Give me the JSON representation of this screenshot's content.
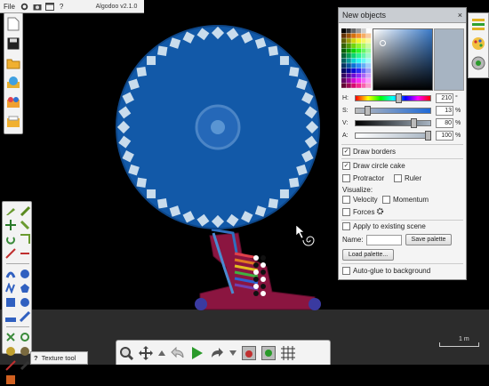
{
  "app": {
    "title": "Algodoo v2.1.0"
  },
  "menu": {
    "file_label": "File",
    "help_label": "?"
  },
  "tooltip": {
    "hint_label": "?",
    "text": "Texture tool"
  },
  "scale": {
    "label": "1 m"
  },
  "new_objects": {
    "title": "New objects",
    "close_label": "×",
    "sliders": [
      {
        "label": "H:",
        "value": "210",
        "unit": "°",
        "fraction": 0.58
      },
      {
        "label": "S:",
        "value": "13",
        "unit": "%",
        "fraction": 0.13
      },
      {
        "label": "V:",
        "value": "80",
        "unit": "%",
        "fraction": 0.8
      },
      {
        "label": "A:",
        "value": "100",
        "unit": "%",
        "fraction": 1.0
      }
    ],
    "draw_borders": {
      "label": "Draw borders",
      "checked": true
    },
    "draw_circle_cake": {
      "label": "Draw circle cake",
      "checked": true
    },
    "protractor": {
      "label": "Protractor",
      "checked": false
    },
    "ruler": {
      "label": "Ruler",
      "checked": false
    },
    "visualize_label": "Visualize:",
    "velocity": {
      "label": "Velocity",
      "checked": false
    },
    "momentum": {
      "label": "Momentum",
      "checked": false
    },
    "forces": {
      "label": "Forces",
      "checked": false
    },
    "apply_existing": {
      "label": "Apply to existing scene",
      "checked": false
    },
    "name_label": "Name:",
    "name_value": "",
    "save_palette_label": "Save palette",
    "load_palette_label": "Load palette...",
    "auto_glue": {
      "label": "Auto-glue to background",
      "checked": false
    },
    "selected_color": "#a7b4c2"
  },
  "colors": {
    "wheel": "#1259a8",
    "wheel_edge": "#0d4688",
    "teeth": "#c9dcec",
    "stand": "#8b1540",
    "ground": "#2c2c2c"
  }
}
